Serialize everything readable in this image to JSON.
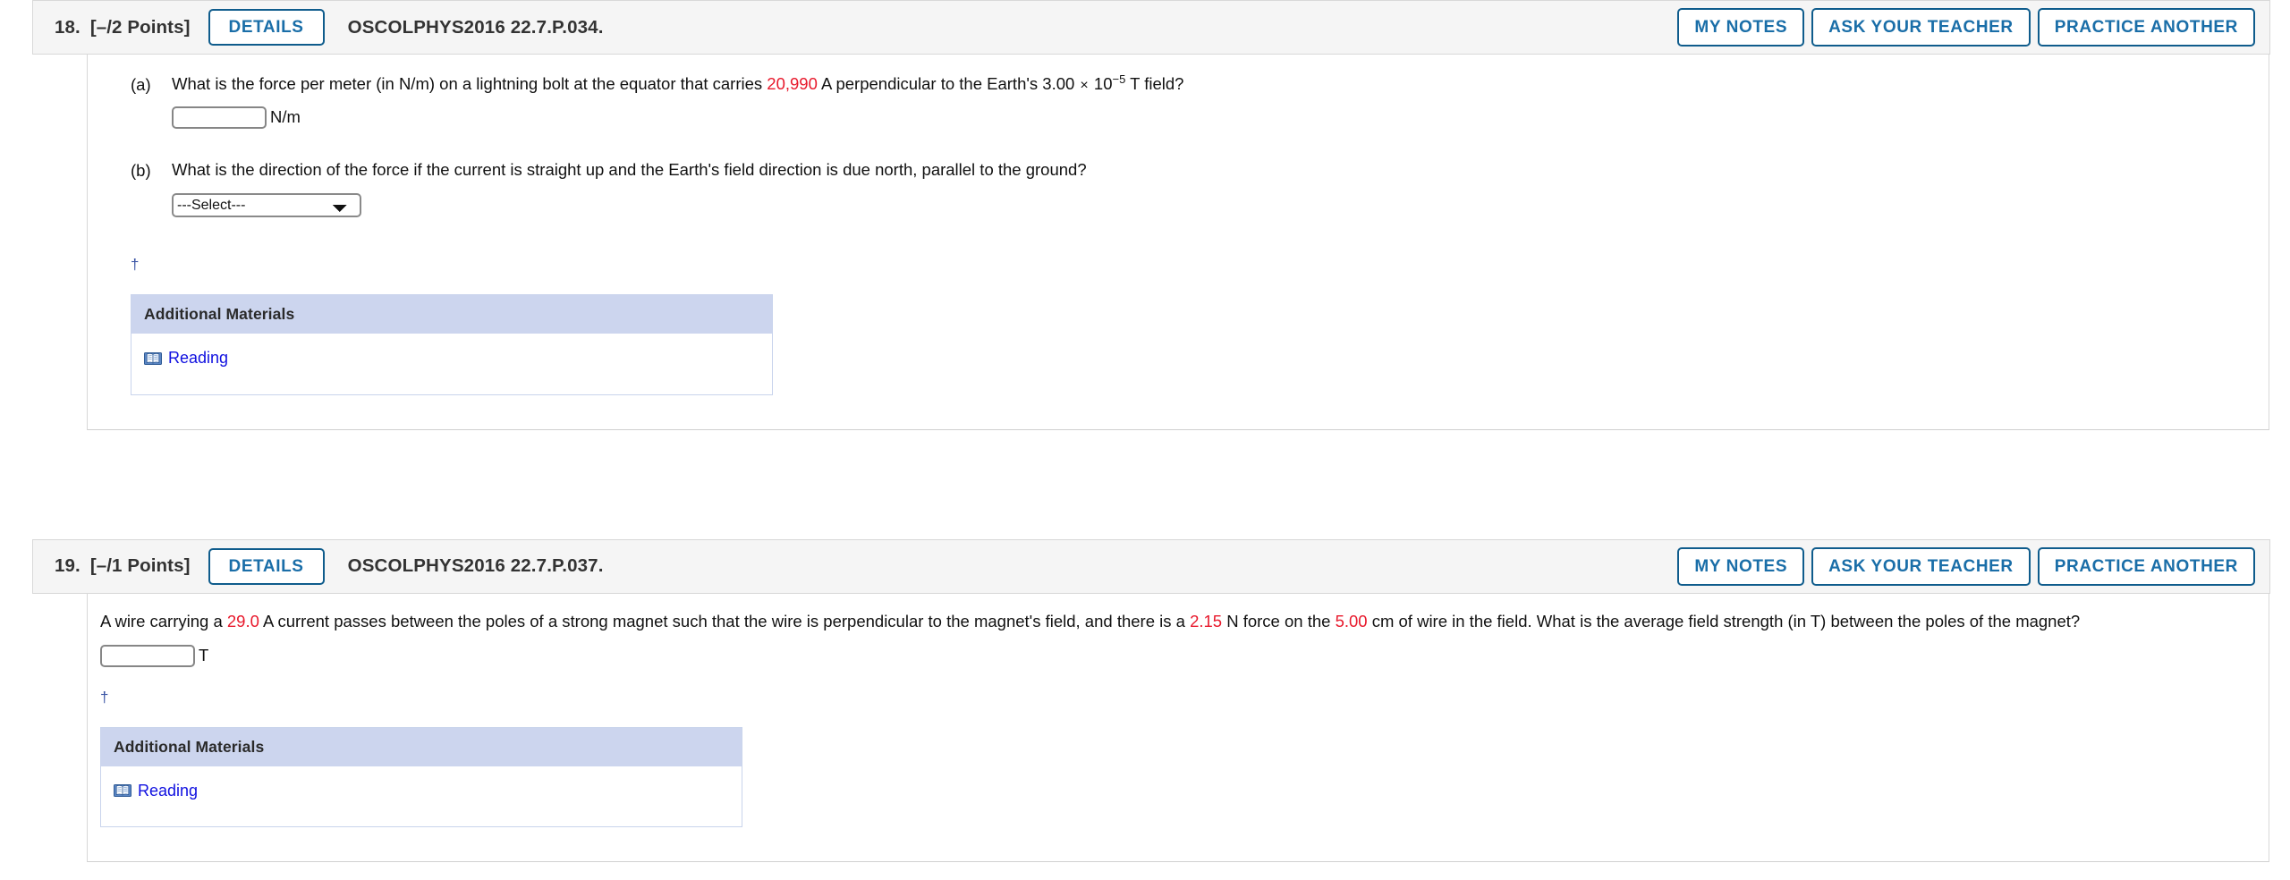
{
  "questions": [
    {
      "number": "18.",
      "points": "[–/2 Points]",
      "details_label": "DETAILS",
      "code": "OSCOLPHYS2016 22.7.P.034.",
      "actions": [
        {
          "label": "MY NOTES",
          "name": "my-notes-button"
        },
        {
          "label": "ASK YOUR TEACHER",
          "name": "ask-your-teacher-button"
        },
        {
          "label": "PRACTICE ANOTHER",
          "name": "practice-another-button"
        }
      ],
      "parts": [
        {
          "label": "(a)",
          "text_before": "What is the force per meter (in N/m) on a lightning bolt at the equator that carries ",
          "highlight": "20,990",
          "text_mid": " A perpendicular to the Earth's 3.00 ",
          "times": "×",
          "base": " 10",
          "exponent": "−5",
          "text_after": " T field?",
          "input_type": "text",
          "input_value": "",
          "unit": "N/m"
        },
        {
          "label": "(b)",
          "text_before": "What is the direction of the force if the current is straight up and the Earth's field direction is due north, parallel to the ground?",
          "input_type": "select",
          "select_value": "---Select---",
          "select_options": [
            "---Select---"
          ]
        }
      ],
      "dagger": "†",
      "materials": {
        "header": "Additional Materials",
        "link_label": "Reading",
        "icon": "book-icon"
      }
    },
    {
      "number": "19.",
      "points": "[–/1 Points]",
      "details_label": "DETAILS",
      "code": "OSCOLPHYS2016 22.7.P.037.",
      "actions": [
        {
          "label": "MY NOTES",
          "name": "my-notes-button"
        },
        {
          "label": "ASK YOUR TEACHER",
          "name": "ask-your-teacher-button"
        },
        {
          "label": "PRACTICE ANOTHER",
          "name": "practice-another-button"
        }
      ],
      "body": {
        "seg1": "A wire carrying a ",
        "hl1": "29.0",
        "seg2": " A current passes between the poles of a strong magnet such that the wire is perpendicular to the magnet's field, and there is a ",
        "hl2": "2.15",
        "seg3": " N force on the ",
        "hl3": "5.00",
        "seg4": " cm of wire in the field. What is the average field strength (in T) between the poles of the magnet?",
        "input_value": "",
        "unit": "T"
      },
      "dagger": "†",
      "materials": {
        "header": "Additional Materials",
        "link_label": "Reading",
        "icon": "book-icon"
      }
    }
  ],
  "colors": {
    "accent_blue": "#1a6ea8",
    "border_blue": "#0f5c8c",
    "highlight_red": "#e8192c",
    "link_blue": "#1010e0",
    "materials_header_bg": "#ccd5ee",
    "header_bg": "#f5f5f5"
  }
}
